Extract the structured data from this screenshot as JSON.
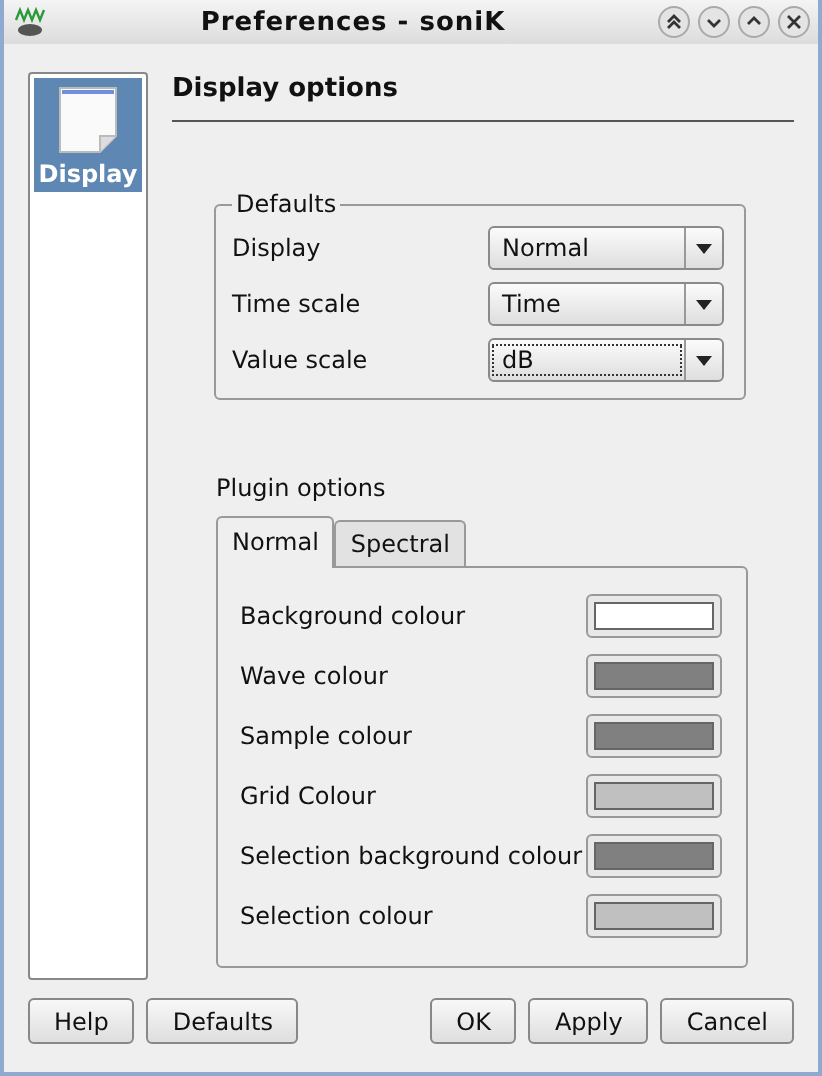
{
  "window": {
    "title": "Preferences - soniK"
  },
  "sidebar": {
    "items": [
      {
        "label": "Display",
        "selected": true
      }
    ]
  },
  "page": {
    "title": "Display options"
  },
  "defaults": {
    "title": "Defaults",
    "rows": [
      {
        "label": "Display",
        "value": "Normal",
        "focused": false
      },
      {
        "label": "Time scale",
        "value": "Time",
        "focused": false
      },
      {
        "label": "Value scale",
        "value": "dB",
        "focused": true
      }
    ]
  },
  "plugin_options": {
    "title": "Plugin options",
    "tabs": [
      {
        "label": "Normal",
        "selected": true
      },
      {
        "label": "Spectral",
        "selected": false
      }
    ],
    "colours": [
      {
        "label": "Background colour",
        "color": "#ffffff"
      },
      {
        "label": "Wave colour",
        "color": "#808080"
      },
      {
        "label": "Sample colour",
        "color": "#808080"
      },
      {
        "label": "Grid Colour",
        "color": "#c0c0c0"
      },
      {
        "label": "Selection background colour",
        "color": "#808080"
      },
      {
        "label": "Selection colour",
        "color": "#c0c0c0"
      }
    ]
  },
  "buttons_left": [
    "Help",
    "Defaults"
  ],
  "buttons_right": [
    "OK",
    "Apply",
    "Cancel"
  ]
}
